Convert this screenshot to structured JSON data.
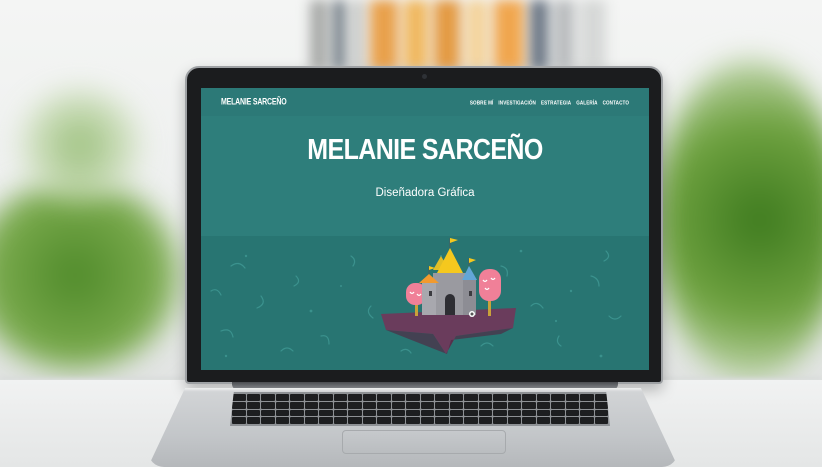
{
  "site": {
    "brand": "MELANIE SARCEÑO",
    "nav": [
      "SOBRE MÍ",
      "INVESTIGACIÓN",
      "ESTRATEGIA",
      "GALERÍA",
      "CONTACTO"
    ],
    "hero_title": "MELANIE SARCEÑO",
    "hero_subtitle": "Diseñadora Gráfica"
  },
  "colors": {
    "teal": "#2e7e7b",
    "teal_dark": "#287572",
    "island": "#6a3c5c",
    "tower_yellow": "#f5c81e",
    "tower_blue": "#62a6d8",
    "tower_orange": "#f29a2e",
    "tree_pink": "#f08098"
  },
  "icons": [
    "floating-castle-island-illustration",
    "webcam-icon"
  ]
}
